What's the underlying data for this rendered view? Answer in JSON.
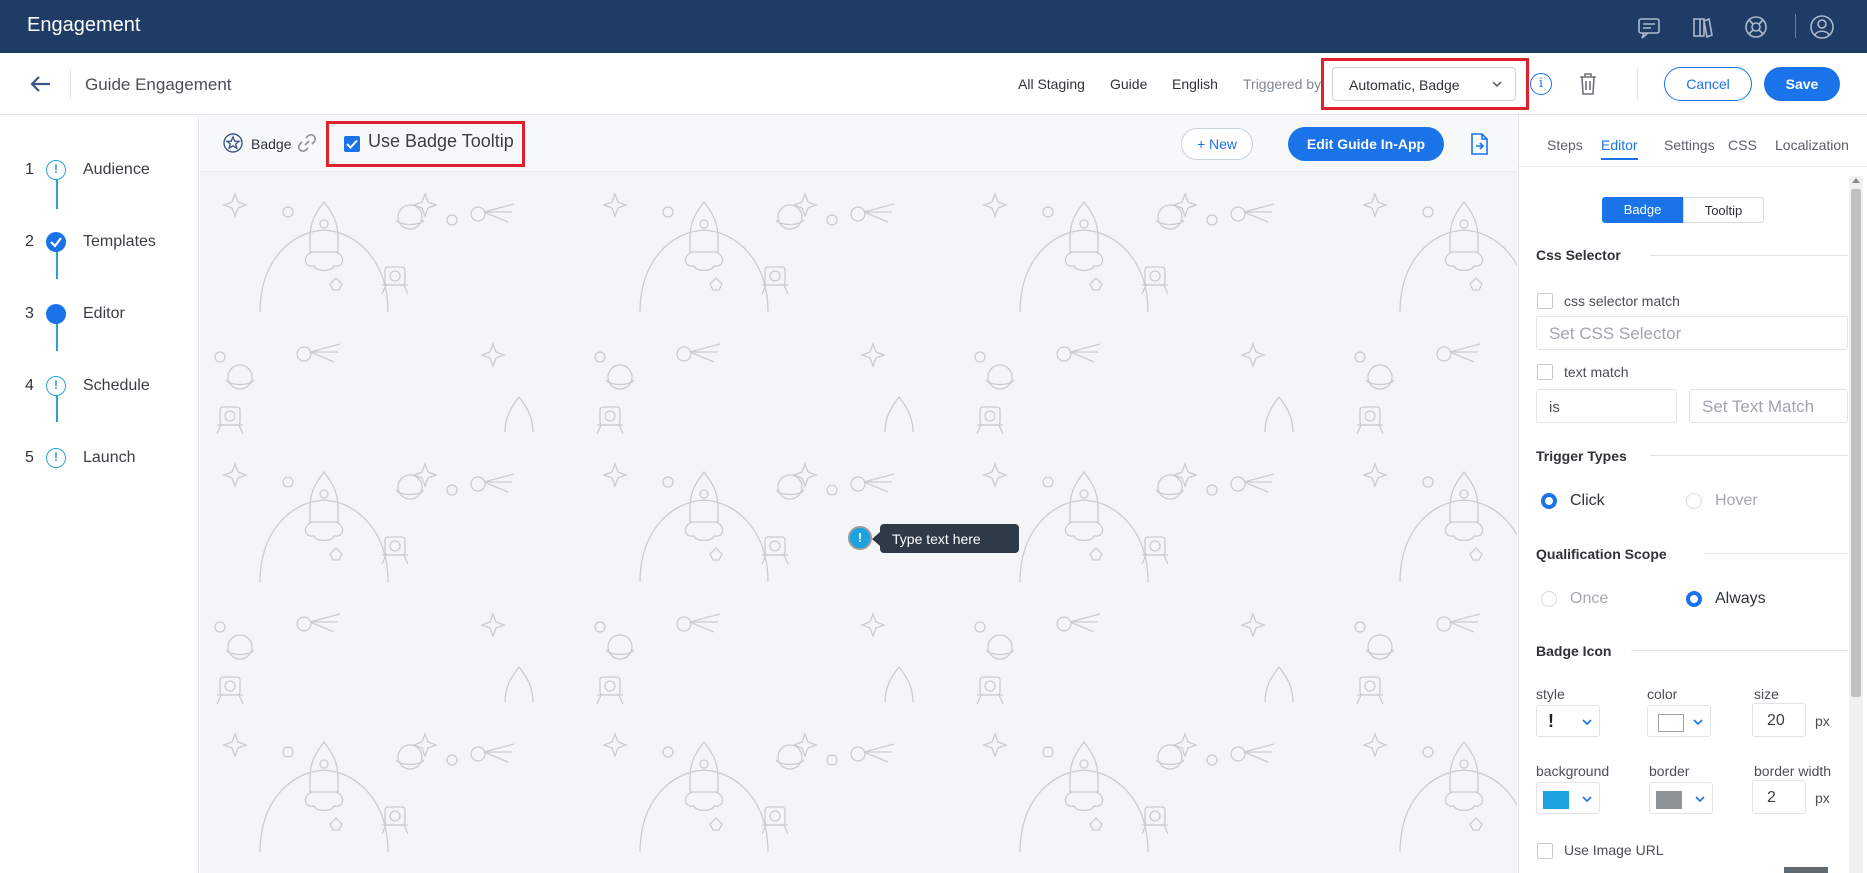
{
  "app": {
    "title": "Engagement"
  },
  "topbar_icons": [
    "chat-icon",
    "book-icon",
    "support-icon",
    "user-icon"
  ],
  "header": {
    "title": "Guide Engagement",
    "environment": "All Staging",
    "type": "Guide",
    "language": "English",
    "triggered_by_label": "Triggered by",
    "triggered_by_value": "Automatic, Badge",
    "info_glyph": "i",
    "cancel_label": "Cancel",
    "save_label": "Save"
  },
  "steps": [
    {
      "num": "1",
      "label": "Audience",
      "state": "warning"
    },
    {
      "num": "2",
      "label": "Templates",
      "state": "done"
    },
    {
      "num": "3",
      "label": "Editor",
      "state": "current"
    },
    {
      "num": "4",
      "label": "Schedule",
      "state": "warning"
    },
    {
      "num": "5",
      "label": "Launch",
      "state": "warning"
    }
  ],
  "toolbar": {
    "badge_label": "Badge",
    "use_tooltip_label": "Use Badge Tooltip",
    "use_tooltip_checked": true,
    "new_label": "+ New",
    "edit_inapp_label": "Edit Guide In-App"
  },
  "canvas": {
    "badge_glyph": "!",
    "tooltip_text": "Type text here"
  },
  "panel": {
    "tabs": [
      "Steps",
      "Editor",
      "Settings",
      "CSS",
      "Localization"
    ],
    "active_tab": "Editor",
    "segment": {
      "badge": "Badge",
      "tooltip": "Tooltip"
    },
    "css_selector": {
      "title": "Css Selector",
      "selector_match_label": "css selector match",
      "selector_placeholder": "Set CSS Selector",
      "text_match_label": "text match",
      "text_match_operator": "is",
      "text_match_placeholder": "Set Text Match"
    },
    "trigger_types": {
      "title": "Trigger Types",
      "click": "Click",
      "hover": "Hover",
      "selected": "Click"
    },
    "qualification_scope": {
      "title": "Qualification Scope",
      "once": "Once",
      "always": "Always",
      "selected": "Always"
    },
    "badge_icon": {
      "title": "Badge Icon",
      "style_label": "style",
      "style_value": "!",
      "color_label": "color",
      "color_value": "#ffffff",
      "size_label": "size",
      "size_value": "20",
      "unit": "px",
      "background_label": "background",
      "background_value": "#1aa3e0",
      "border_label": "border",
      "border_value": "#8e9395",
      "border_width_label": "border width",
      "border_width_value": "2",
      "use_image_url_label": "Use Image URL"
    }
  },
  "colors": {
    "topbar": "#1e3c66",
    "accent": "#1a73e8",
    "highlight": "#e0202a",
    "step_line": "#2a9fd8",
    "tooltip_bg": "#2f3a48"
  }
}
